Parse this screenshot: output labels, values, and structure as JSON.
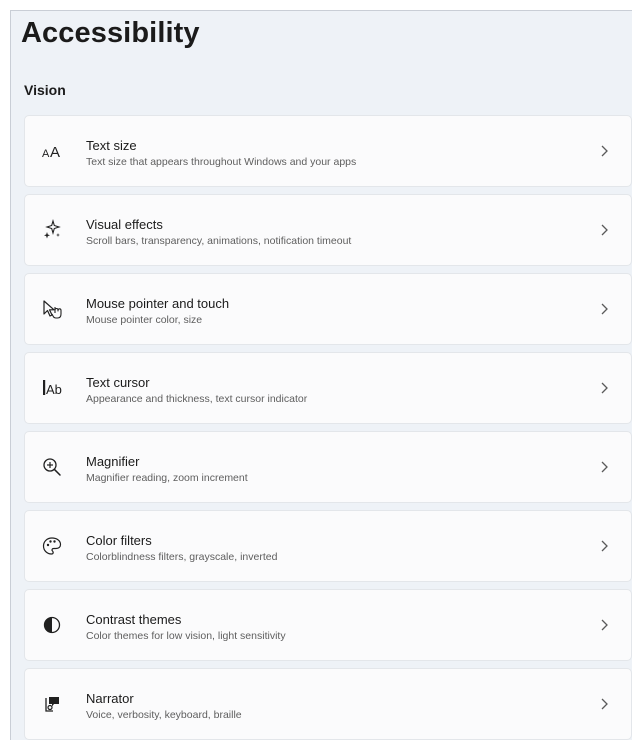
{
  "page": {
    "title": "Accessibility",
    "section_title": "Vision"
  },
  "items": [
    {
      "label": "Text size",
      "description": "Text size that appears throughout Windows and your apps",
      "icon": "text-size-icon"
    },
    {
      "label": "Visual effects",
      "description": "Scroll bars, transparency, animations, notification timeout",
      "icon": "visual-effects-icon"
    },
    {
      "label": "Mouse pointer and touch",
      "description": "Mouse pointer color, size",
      "icon": "mouse-pointer-icon"
    },
    {
      "label": "Text cursor",
      "description": "Appearance and thickness, text cursor indicator",
      "icon": "text-cursor-icon"
    },
    {
      "label": "Magnifier",
      "description": "Magnifier reading, zoom increment",
      "icon": "magnifier-icon"
    },
    {
      "label": "Color filters",
      "description": "Colorblindness filters, grayscale, inverted",
      "icon": "color-filters-icon"
    },
    {
      "label": "Contrast themes",
      "description": "Color themes for low vision, light sensitivity",
      "icon": "contrast-themes-icon"
    },
    {
      "label": "Narrator",
      "description": "Voice, verbosity, keyboard, braille",
      "icon": "narrator-icon"
    }
  ]
}
